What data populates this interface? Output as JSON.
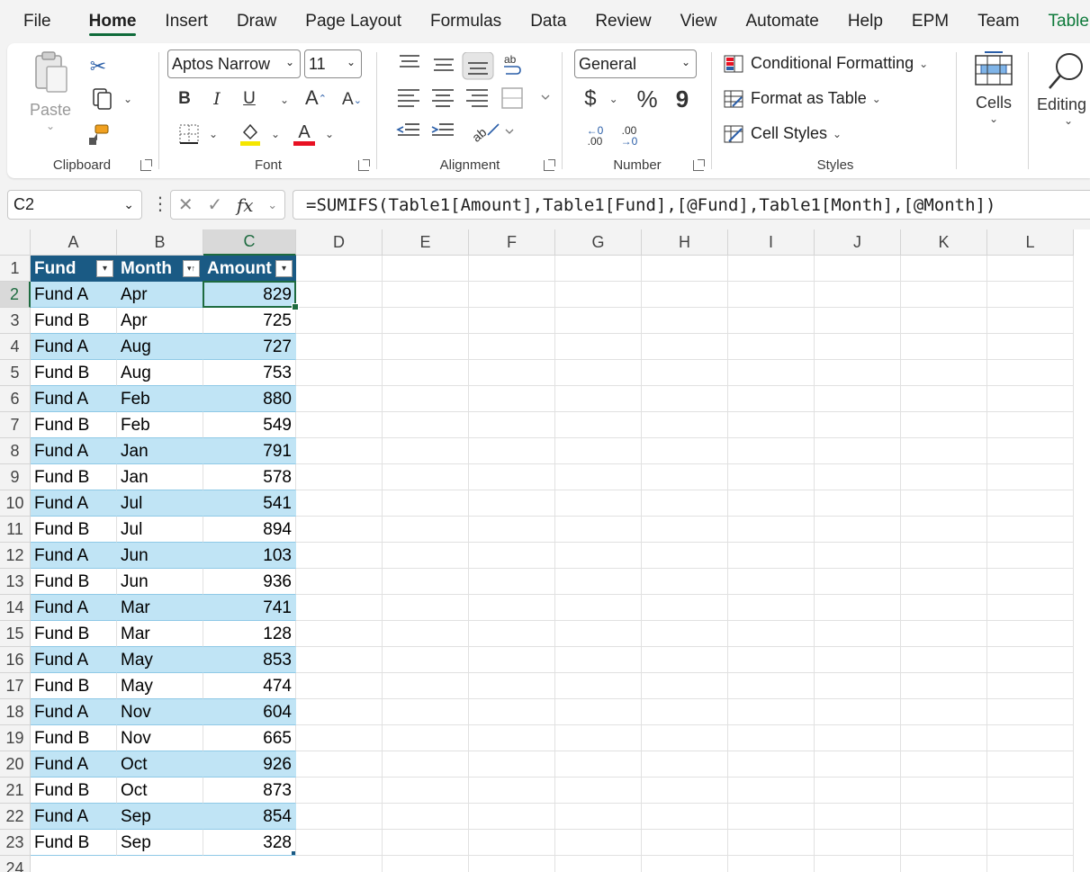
{
  "tabs": [
    "File",
    "Home",
    "Insert",
    "Draw",
    "Page Layout",
    "Formulas",
    "Data",
    "Review",
    "View",
    "Automate",
    "Help",
    "EPM",
    "Team",
    "Table Design"
  ],
  "active_tab": "Home",
  "ribbon": {
    "clipboard": {
      "label": "Clipboard",
      "paste": "Paste"
    },
    "font": {
      "label": "Font",
      "name": "Aptos Narrow",
      "size": "11",
      "bold": "B",
      "italic": "I",
      "underline": "U",
      "grow": "A",
      "shrink": "A"
    },
    "alignment": {
      "label": "Alignment"
    },
    "number": {
      "label": "Number",
      "format": "General",
      "currency": "$",
      "percent": "%",
      "comma": "9",
      "inc_dec": ".00",
      "dec_dec": ".00"
    },
    "styles": {
      "label": "Styles",
      "conditional": "Conditional Formatting",
      "format_table": "Format as Table",
      "cell_styles": "Cell Styles"
    },
    "cells": {
      "label": "Cells"
    },
    "editing": {
      "label": "Editing"
    }
  },
  "formula_bar": {
    "name_box": "C2",
    "formula": "=SUMIFS(Table1[Amount],Table1[Fund],[@Fund],Table1[Month],[@Month])"
  },
  "columns": [
    "A",
    "B",
    "C",
    "D",
    "E",
    "F",
    "G",
    "H",
    "I",
    "J",
    "K",
    "L"
  ],
  "selected_column": "C",
  "selected_row": 2,
  "table": {
    "headers": [
      "Fund",
      "Month",
      "Amount"
    ],
    "rows": [
      [
        "Fund A",
        "Apr",
        "829"
      ],
      [
        "Fund B",
        "Apr",
        "725"
      ],
      [
        "Fund A",
        "Aug",
        "727"
      ],
      [
        "Fund B",
        "Aug",
        "753"
      ],
      [
        "Fund A",
        "Feb",
        "880"
      ],
      [
        "Fund B",
        "Feb",
        "549"
      ],
      [
        "Fund A",
        "Jan",
        "791"
      ],
      [
        "Fund B",
        "Jan",
        "578"
      ],
      [
        "Fund A",
        "Jul",
        "541"
      ],
      [
        "Fund B",
        "Jul",
        "894"
      ],
      [
        "Fund A",
        "Jun",
        "103"
      ],
      [
        "Fund B",
        "Jun",
        "936"
      ],
      [
        "Fund A",
        "Mar",
        "741"
      ],
      [
        "Fund B",
        "Mar",
        "128"
      ],
      [
        "Fund A",
        "May",
        "853"
      ],
      [
        "Fund B",
        "May",
        "474"
      ],
      [
        "Fund A",
        "Nov",
        "604"
      ],
      [
        "Fund B",
        "Nov",
        "665"
      ],
      [
        "Fund A",
        "Oct",
        "926"
      ],
      [
        "Fund B",
        "Oct",
        "873"
      ],
      [
        "Fund A",
        "Sep",
        "854"
      ],
      [
        "Fund B",
        "Sep",
        "328"
      ]
    ]
  },
  "row_numbers": [
    "1",
    "2",
    "3",
    "4",
    "5",
    "6",
    "7",
    "8",
    "9",
    "10",
    "11",
    "12",
    "13",
    "14",
    "15",
    "16",
    "17",
    "18",
    "19",
    "20",
    "21",
    "22",
    "23",
    "24"
  ],
  "colors": {
    "table_header": "#1a5a84",
    "band": "#c0e4f5",
    "selection": "#1e6b40",
    "accent_tab": "#0f6b3a"
  }
}
